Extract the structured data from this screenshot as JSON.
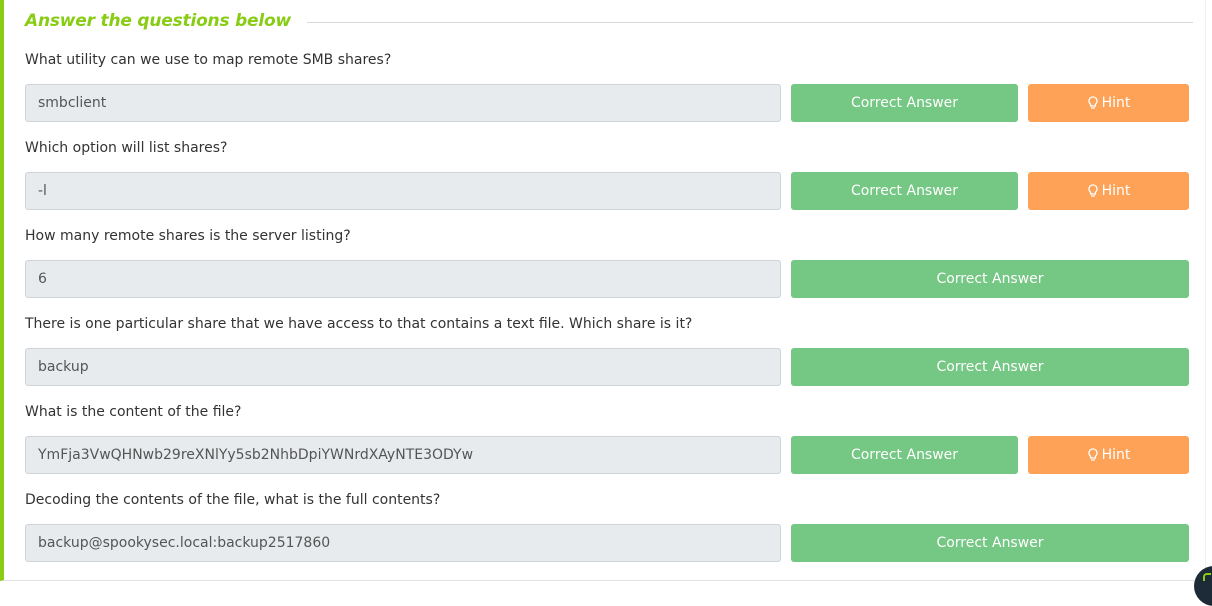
{
  "section": {
    "title": "Answer the questions below"
  },
  "buttons": {
    "correct_label": "Correct Answer",
    "hint_label": "Hint"
  },
  "questions": [
    {
      "text": "What utility can we use to map remote SMB shares?",
      "answer": "smbclient",
      "has_hint": true
    },
    {
      "text": "Which option will list shares?",
      "answer": "-l",
      "has_hint": true
    },
    {
      "text": "How many remote shares is the server listing?",
      "answer": "6",
      "has_hint": false
    },
    {
      "text": "There is one particular share that we have access to that contains a text file. Which share is it?",
      "answer": "backup",
      "has_hint": false
    },
    {
      "text": "What is the content of the file?",
      "answer": "YmFja3VwQHNwb29reXNlYy5sb2NhbDpiYWNrdXAyNTE3ODYw",
      "has_hint": true
    },
    {
      "text": "Decoding the contents of the file, what is the full contents?",
      "answer": "backup@spookysec.local:backup2517860",
      "has_hint": false
    }
  ],
  "colors": {
    "accent": "#88cc14",
    "correct": "#75c784",
    "hint": "#fda257"
  }
}
